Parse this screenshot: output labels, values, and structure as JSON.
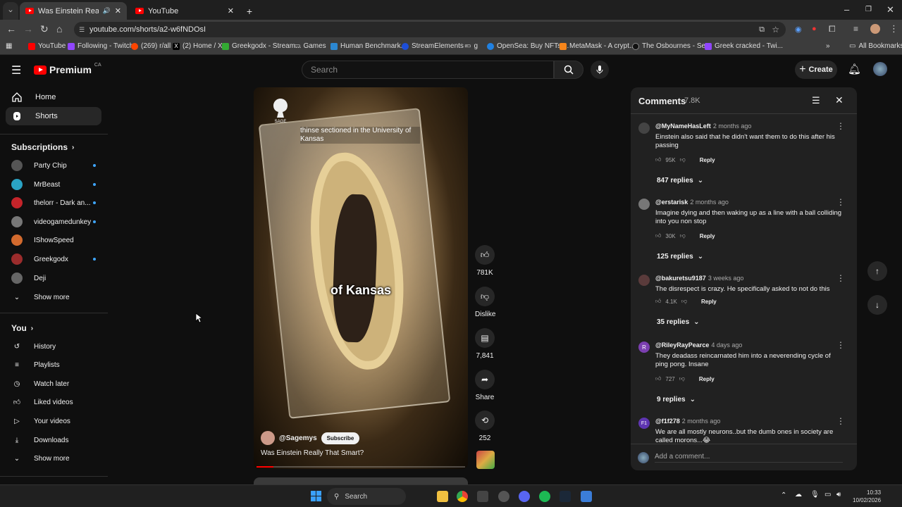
{
  "browser": {
    "tabs": [
      {
        "title": "Was Einstein Really That Sm",
        "active": true
      },
      {
        "title": "YouTube",
        "active": false
      }
    ],
    "url": "youtube.com/shorts/a2-w6fNDOsI",
    "bookmarks": [
      "YouTube",
      "Following - Twitch",
      "(269) r/all",
      "(2) Home / X",
      "Greekgodx - Stream...",
      "Games",
      "Human Benchmark...",
      "StreamElements -",
      "g",
      "OpenSea: Buy NFTs,...",
      "MetaMask - A crypt...",
      "The Osbournes - Se...",
      "Greek cracked - Twi..."
    ],
    "all_bookmarks": "All Bookmarks"
  },
  "header": {
    "logo": "Premium",
    "region": "CA",
    "search_placeholder": "Search",
    "create_label": "Create"
  },
  "sidebar": {
    "main": [
      {
        "label": "Home",
        "icon": "home-icon"
      },
      {
        "label": "Shorts",
        "icon": "shorts-icon",
        "selected": true
      }
    ],
    "subscriptions_title": "Subscriptions",
    "subscriptions": [
      {
        "label": "Party Chip",
        "color": "#555555"
      },
      {
        "label": "MrBeast",
        "color": "#2aa3c4"
      },
      {
        "label": "thelorr - Dark an...",
        "color": "#c4242a"
      },
      {
        "label": "videogamedunkey",
        "color": "#777777"
      },
      {
        "label": "IShowSpeed",
        "color": "#d26a2e"
      },
      {
        "label": "Greekgodx",
        "color": "#9b2c2c"
      },
      {
        "label": "Deji",
        "color": "#666666"
      }
    ],
    "show_more": "Show more",
    "you_title": "You",
    "you_items": [
      {
        "label": "History",
        "icon": "history-icon"
      },
      {
        "label": "Playlists",
        "icon": "playlists-icon"
      },
      {
        "label": "Watch later",
        "icon": "watch-later-icon"
      },
      {
        "label": "Liked videos",
        "icon": "liked-videos-icon"
      },
      {
        "label": "Your videos",
        "icon": "your-videos-icon"
      },
      {
        "label": "Downloads",
        "icon": "downloads-icon"
      }
    ],
    "show_more_2": "Show more"
  },
  "short": {
    "brand": "SAGE",
    "caption_top": "thinse sectioned in the University of Kansas",
    "caption_mid": "of Kansas",
    "channel": "@Sagemys",
    "subscribe": "Subscribe",
    "title": "Was Einstein Really That Smart?",
    "progress": 0.08
  },
  "actions": {
    "likes": "781K",
    "dislike": "Dislike",
    "comments": "7,841",
    "share": "Share",
    "remix": "252"
  },
  "comments_panel": {
    "title": "Comments",
    "count": "7.8K",
    "comments": [
      {
        "author": "@MyNameHasLeft",
        "time": "2 months ago",
        "text": "Einstein also said that he didn't want them to do this after his passing",
        "likes": "95K",
        "replies": "847 replies",
        "avatar_color": "#444444",
        "initial": ""
      },
      {
        "author": "@erstarisk",
        "time": "2 months ago",
        "text": "Imagine dying and then waking up as a line with a ball colliding into you non stop",
        "likes": "30K",
        "replies": "125 replies",
        "avatar_color": "#777777",
        "initial": ""
      },
      {
        "author": "@bakuretsu9187",
        "time": "3 weeks ago",
        "text": "The disrespect is crazy. He specifically asked to not do this",
        "likes": "4.1K",
        "replies": "35 replies",
        "avatar_color": "#5a3b3b",
        "initial": ""
      },
      {
        "author": "@RileyRayPearce",
        "time": "4 days ago",
        "text": "They deadass reincarnated him into a neverending cycle of ping pong. Insane",
        "likes": "727",
        "replies": "9 replies",
        "avatar_color": "#7b3fb0",
        "initial": "R"
      },
      {
        "author": "@f1f278",
        "time": "2 months ago",
        "text": "We are all mostly neurons..but the dumb ones in society are called morons...😂",
        "likes": "",
        "replies": "",
        "avatar_color": "#5e35b1",
        "initial": "F1"
      }
    ],
    "reply_label": "Reply",
    "add_comment": "Add a comment..."
  },
  "taskbar": {
    "search": "Search",
    "time": "10:33",
    "date": "10/02/2026"
  }
}
